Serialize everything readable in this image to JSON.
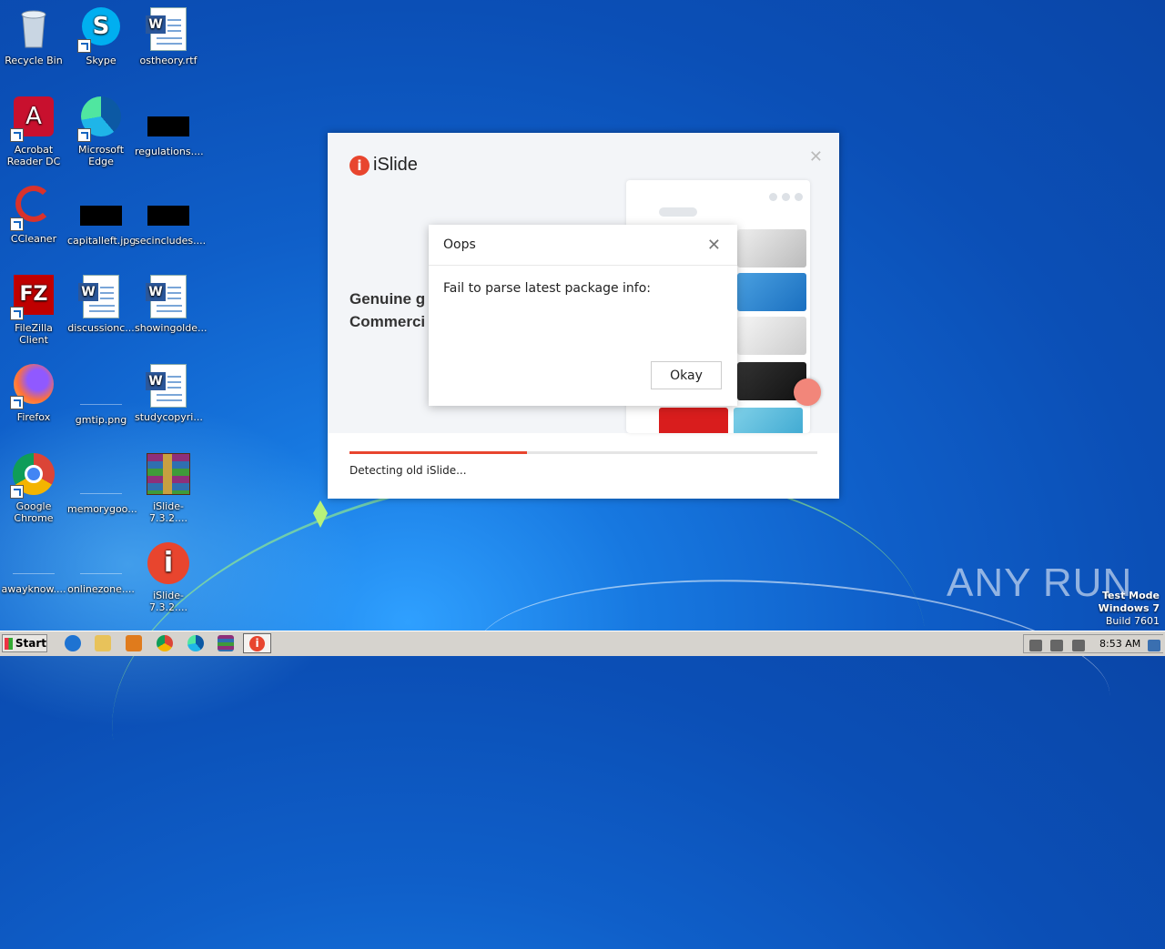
{
  "desktop": {
    "icons": [
      {
        "label": "Recycle Bin"
      },
      {
        "label": "Skype"
      },
      {
        "label": "ostheory.rtf"
      },
      {
        "label": "Acrobat Reader DC"
      },
      {
        "label": "Microsoft Edge"
      },
      {
        "label": "regulations...."
      },
      {
        "label": "CCleaner"
      },
      {
        "label": "capitalleft.jpg"
      },
      {
        "label": "secincludes...."
      },
      {
        "label": "FileZilla Client"
      },
      {
        "label": "discussionc..."
      },
      {
        "label": "showingolde..."
      },
      {
        "label": "Firefox"
      },
      {
        "label": "gmtip.png"
      },
      {
        "label": "studycopyri..."
      },
      {
        "label": "Google Chrome"
      },
      {
        "label": "memorygoo..."
      },
      {
        "label": "iSlide-7.3.2...."
      },
      {
        "label": "awayknow...."
      },
      {
        "label": "onlinezone...."
      },
      {
        "label": "iSlide-7.3.2...."
      }
    ]
  },
  "islide_window": {
    "brand": "iSlide",
    "headline_line1": "Genuine g",
    "headline_line2": "Commerci",
    "progress": 0.38,
    "status": "Detecting old iSlide...",
    "accent": "#e8452e"
  },
  "dialog": {
    "title": "Oops",
    "message": "Fail to parse latest package info:",
    "ok_label": "Okay"
  },
  "watermark": {
    "text": "ANY RUN",
    "test_mode": "Test Mode",
    "os": "Windows 7",
    "build": "Build 7601"
  },
  "taskbar": {
    "start_label": "Start",
    "clock": "8:53 AM"
  }
}
